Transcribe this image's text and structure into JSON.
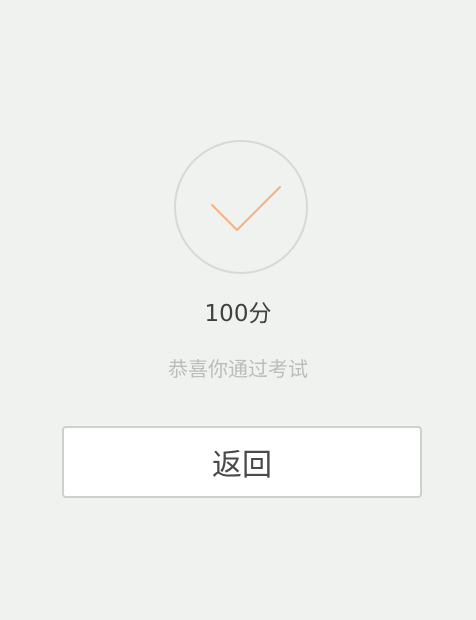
{
  "result": {
    "icon": "checkmark-icon",
    "check_color": "#f4b183",
    "circle_color": "#d8d8d6",
    "score_text": "100分",
    "message": "恭喜你通过考试"
  },
  "actions": {
    "back_label": "返回"
  },
  "colors": {
    "background": "#eff2ee",
    "score_text": "#404040",
    "message_text": "#bcbcbc"
  }
}
